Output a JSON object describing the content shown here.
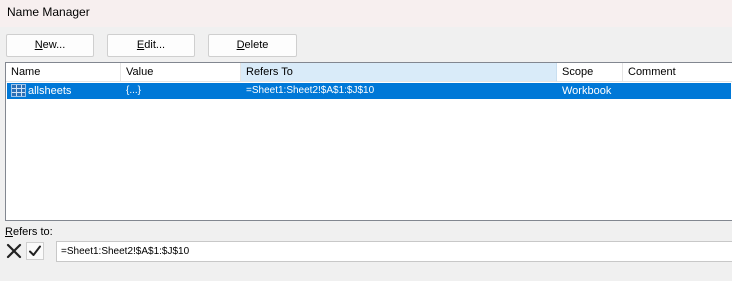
{
  "window": {
    "title": "Name Manager"
  },
  "toolbar": {
    "new_prefix": "",
    "new_underline": "N",
    "new_rest": "ew...",
    "edit_prefix": "",
    "edit_underline": "E",
    "edit_rest": "dit...",
    "delete_prefix": "",
    "delete_underline": "D",
    "delete_rest": "elete"
  },
  "table": {
    "columns": [
      "Name",
      "Value",
      "Refers To",
      "Scope",
      "Comment"
    ],
    "sorted_column": "Refers To",
    "rows": [
      {
        "name": "allsheets",
        "value": "{...}",
        "refers_to": "=Sheet1:Sheet2!$A$1:$J$10",
        "scope": "Workbook",
        "comment": "",
        "selected": true,
        "icon": "named-range-icon"
      }
    ]
  },
  "refers": {
    "label_underline": "R",
    "label_rest": "efers to:",
    "value": "=Sheet1:Sheet2!$A$1:$J$10"
  },
  "colors": {
    "selection": "#0078d7",
    "sorted_header": "#d9ebf9"
  }
}
